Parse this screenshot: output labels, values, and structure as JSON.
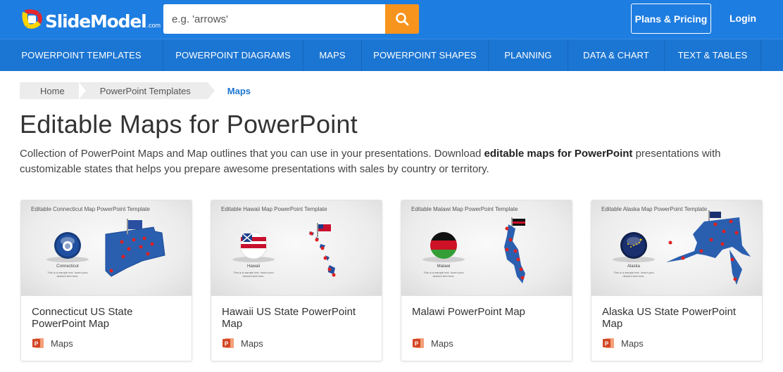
{
  "header": {
    "logo_text": "SlideModel",
    "logo_suffix": ".com",
    "search_placeholder": "e.g. 'arrows'",
    "search_icon": "search-icon",
    "plans_label": "Plans & Pricing",
    "login_label": "Login",
    "colors": {
      "bar": "#1e7de0",
      "search_button": "#f7941d"
    }
  },
  "nav": {
    "items": [
      {
        "label": "POWERPOINT TEMPLATES"
      },
      {
        "label": "POWERPOINT DIAGRAMS"
      },
      {
        "label": "MAPS"
      },
      {
        "label": "POWERPOINT SHAPES"
      },
      {
        "label": "PLANNING"
      },
      {
        "label": "DATA & CHART"
      },
      {
        "label": "TEXT & TABLES"
      }
    ]
  },
  "breadcrumb": {
    "home": "Home",
    "parent": "PowerPoint Templates",
    "current": "Maps"
  },
  "page": {
    "title": "Editable Maps for PowerPoint",
    "intro_before": "Collection of PowerPoint Maps and Map outlines that you can use in your presentations. Download ",
    "intro_bold": "editable maps for PowerPoint",
    "intro_after": " presentations with customizable states that helps you prepare awesome presentations with sales by country or territory."
  },
  "cards": [
    {
      "thumb_title": "Editable Connecticut Map PowerPoint Template",
      "thumb_caption": "Connecticut",
      "thumb_sub": "This is a sample text. Insert your desired text here.",
      "title": "Connecticut US State PowerPoint Map",
      "category": "Maps"
    },
    {
      "thumb_title": "Editable Hawaii Map PowerPoint Template",
      "thumb_caption": "Hawaii",
      "thumb_sub": "This is a sample text. Insert your desired text here.",
      "title": "Hawaii US State PowerPoint Map",
      "category": "Maps"
    },
    {
      "thumb_title": "Editable Malawi Map PowerPoint Template",
      "thumb_caption": "Malawi",
      "thumb_sub": "This is a sample text. Insert your desired text here.",
      "title": "Malawi PowerPoint Map",
      "category": "Maps"
    },
    {
      "thumb_title": "Editable Alaska Map PowerPoint Template",
      "thumb_caption": "Alaska",
      "thumb_sub": "This is a sample text. Insert your desired text here.",
      "title": "Alaska US State PowerPoint Map",
      "category": "Maps"
    }
  ]
}
